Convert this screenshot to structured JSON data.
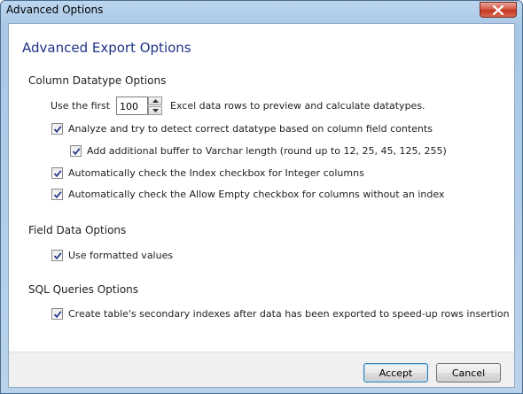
{
  "window": {
    "title": "Advanced Options"
  },
  "heading": "Advanced Export Options",
  "column_datatype": {
    "section_title": "Column Datatype Options",
    "use_first_label": "Use the first",
    "rows_value": "100",
    "rows_suffix": "Excel data rows to preview and calculate datatypes.",
    "options": [
      {
        "label": "Analyze and try to detect correct datatype based on column field contents",
        "checked": true
      },
      {
        "label": "Add additional buffer to Varchar length (round up to 12, 25, 45, 125, 255)",
        "checked": true
      },
      {
        "label": "Automatically check the Index checkbox for Integer columns",
        "checked": true
      },
      {
        "label": "Automatically check the Allow Empty checkbox for columns without an index",
        "checked": true
      }
    ]
  },
  "field_data": {
    "section_title": "Field Data Options",
    "options": [
      {
        "label": "Use formatted values",
        "checked": true
      }
    ]
  },
  "sql_queries": {
    "section_title": "SQL Queries Options",
    "options": [
      {
        "label": "Create table's secondary indexes after data has been exported to speed-up rows insertion",
        "checked": true
      }
    ]
  },
  "buttons": {
    "accept": "Accept",
    "cancel": "Cancel"
  },
  "colors": {
    "heading": "#1e3287",
    "close_button": "#c23520"
  }
}
